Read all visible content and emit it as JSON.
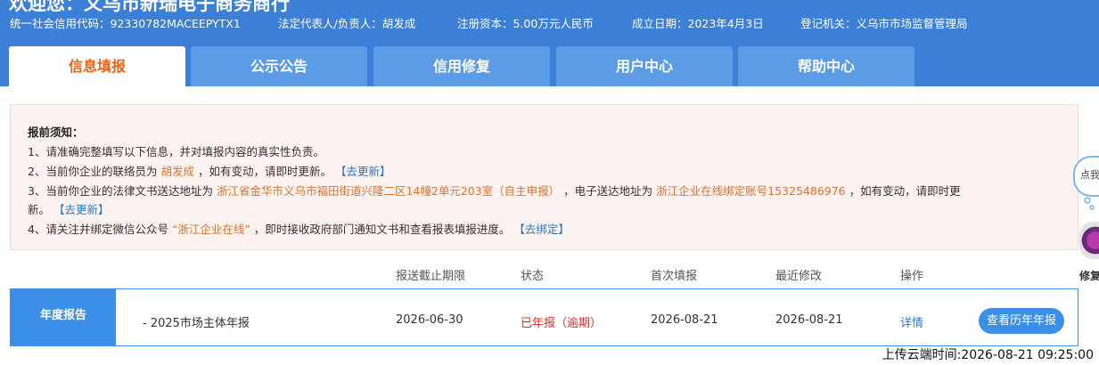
{
  "header": {
    "welcome": "欢迎您：义乌市新瑞电子商务商行",
    "credit_code": "统一社会信用代码：92330782MACEEPYTX1",
    "legal_rep": "法定代表人/负责人：胡发成",
    "capital": "注册资本：5.00万元人民币",
    "founded": "成立日期：2023年4月3日",
    "authority": "登记机关：义乌市市场监督管理局"
  },
  "tabs": [
    {
      "label": "信息填报",
      "active": true
    },
    {
      "label": "公示公告",
      "active": false
    },
    {
      "label": "信用修复",
      "active": false
    },
    {
      "label": "用户中心",
      "active": false
    },
    {
      "label": "帮助中心",
      "active": false
    }
  ],
  "notice": {
    "title": "报前须知：",
    "line1": "1、请准确完整填写以下信息，并对填报内容的真实性负责。",
    "line2_pre": "2、当前你企业的联络员为",
    "line2_name": "胡发成",
    "line2_post": "，如有变动，请即时更新。",
    "line2_link": "【去更新】",
    "line3_pre": "3、当前你企业的法律文书送达地址为",
    "line3_addr": "浙江省金华市义乌市福田街道兴隆二区14幢2单元203室（自主申报）",
    "line3_mid": "，电子送达地址为",
    "line3_eaddr": "浙江企业在线绑定账号15325486976",
    "line3_post": "，如有变动，请即时更",
    "line3_cont": "新。",
    "line3_link": "【去更新】",
    "line4_pre": "4、请关注并绑定微信公众号",
    "line4_name": "“浙江企业在线”",
    "line4_post": "，即时接收政府部门通知文书和查看报表填报进度。",
    "line4_link": "【去绑定】"
  },
  "table": {
    "headers": {
      "deadline": "报送截止期限",
      "status": "状态",
      "first": "首次填报",
      "modified": "最近修改",
      "action": "操作"
    },
    "row": {
      "label": "年度报告",
      "name": "- 2025市场主体年报",
      "deadline": "2026-06-30",
      "status": "已年报（逾期）",
      "first": "2026-08-21",
      "modified": "2026-08-21",
      "detail": "详情",
      "history_button": "查看历年年报"
    }
  },
  "upload_time": "上传云端时间:2026-08-21 09:25:00",
  "side": {
    "bubble": "点我",
    "label": "修复"
  },
  "colors": {
    "header_bg": "#3c7fd6",
    "tab_bg": "#5c9ce6",
    "active_tab_text": "#e8621a",
    "row_accent": "#3c8fe8",
    "status_red": "#e0282e",
    "highlight_orange": "#e0712a",
    "link_blue": "#2a78c8"
  }
}
